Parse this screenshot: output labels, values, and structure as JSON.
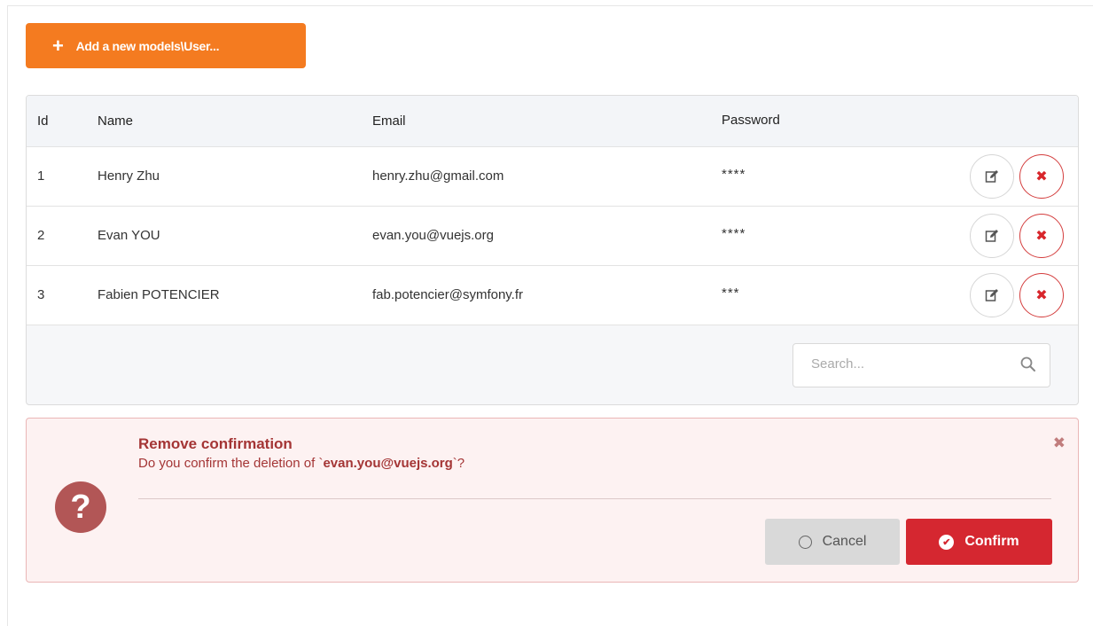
{
  "toolbar": {
    "add_label": "Add a new models\\User...",
    "add_icon": "plus-icon"
  },
  "table": {
    "columns": [
      "Id",
      "Name",
      "Email",
      "Password"
    ],
    "rows": [
      {
        "id": "1",
        "name": "Henry Zhu",
        "email": "henry.zhu@gmail.com",
        "password": "****"
      },
      {
        "id": "2",
        "name": "Evan YOU",
        "email": "evan.you@vuejs.org",
        "password": "****"
      },
      {
        "id": "3",
        "name": "Fabien POTENCIER",
        "email": "fab.potencier@symfony.fr",
        "password": "***"
      }
    ],
    "row_actions": {
      "edit_icon": "edit-icon",
      "delete_icon": "close-icon"
    }
  },
  "search": {
    "placeholder": "Search...",
    "value": ""
  },
  "confirmation": {
    "title": "Remove confirmation",
    "message_prefix": "Do you confirm the deletion of `",
    "message_target": "evan.you@vuejs.org",
    "message_suffix": "`?",
    "cancel_label": "Cancel",
    "confirm_label": "Confirm"
  },
  "colors": {
    "accent": "#f47b20",
    "danger": "#d52730",
    "alert_bg": "#fdf2f2",
    "alert_text": "#a43535"
  }
}
